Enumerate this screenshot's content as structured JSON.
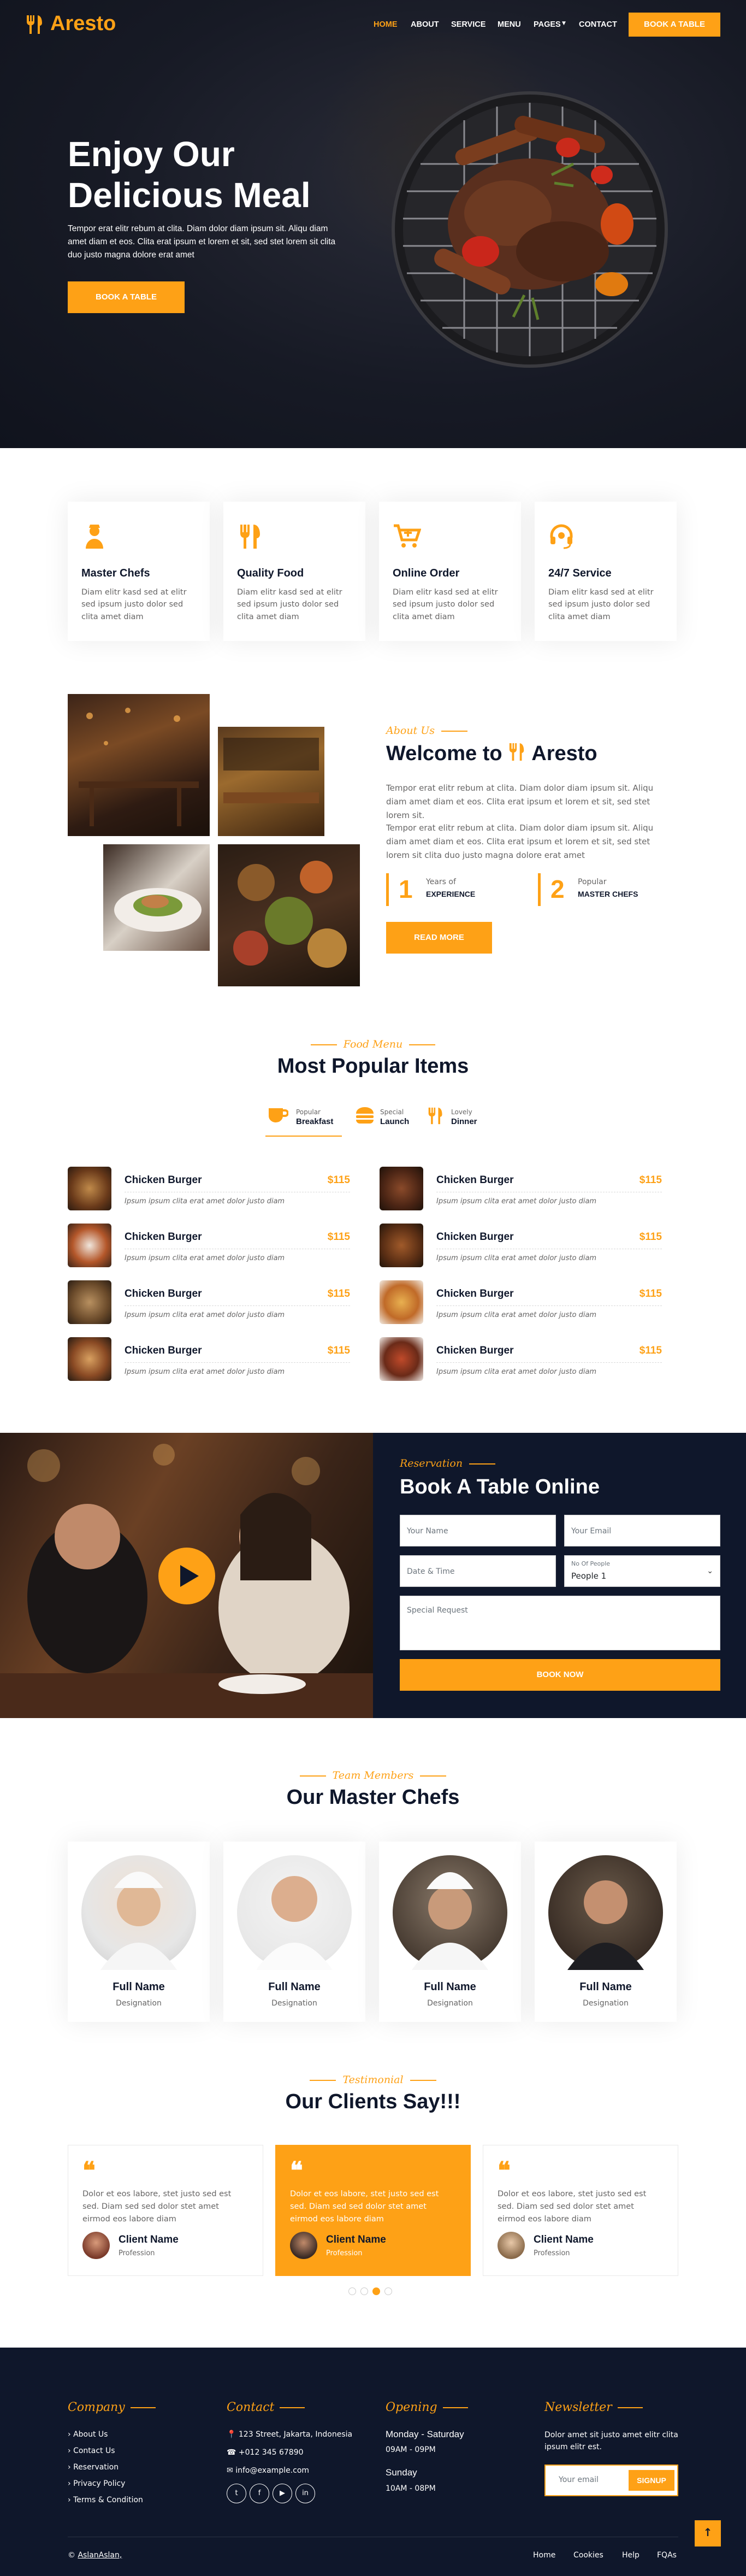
{
  "brand": {
    "name": "Aresto"
  },
  "nav": {
    "items": [
      "HOME",
      "ABOUT",
      "SERVICE",
      "MENU",
      "PAGES"
    ],
    "contact": "CONTACT",
    "cta": "BOOK A TABLE"
  },
  "hero": {
    "title_line1": "Enjoy Our",
    "title_line2": "Delicious Meal",
    "text_line1": "Tempor erat elitr rebum at clita. Diam dolor diam ipsum sit. Aliqu diam",
    "text_line2": "amet diam et eos. Clita erat ipsum et lorem et sit, sed stet lorem sit clita",
    "text_line3": "duo justo magna dolore erat amet",
    "button": "BOOK A TABLE"
  },
  "services": [
    {
      "title": "Master Chefs",
      "icon": "chef-icon",
      "text": "Diam elitr kasd sed at elitr sed ipsum justo dolor sed clita amet diam"
    },
    {
      "title": "Quality Food",
      "icon": "utensils-icon",
      "text": "Diam elitr kasd sed at elitr sed ipsum justo dolor sed clita amet diam"
    },
    {
      "title": "Online Order",
      "icon": "cart-icon",
      "text": "Diam elitr kasd sed at elitr sed ipsum justo dolor sed clita amet diam"
    },
    {
      "title": "24/7 Service",
      "icon": "headset-icon",
      "text": "Diam elitr kasd sed at elitr sed ipsum justo dolor sed clita amet diam"
    }
  ],
  "about": {
    "subtitle": "About Us",
    "title_prefix": "Welcome to",
    "title_brand": "Aresto",
    "para1": "Tempor erat elitr rebum at clita. Diam dolor diam ipsum sit. Aliqu diam amet diam et eos. Clita erat ipsum et lorem et sit, sed stet lorem sit.",
    "para2": "Tempor erat elitr rebum at clita. Diam dolor diam ipsum sit. Aliqu diam amet diam et eos. Clita erat ipsum et lorem et sit, sed stet lorem sit clita duo justo magna dolore erat amet",
    "stat1": {
      "num": "1",
      "label1": "Years of",
      "label2": "EXPERIENCE"
    },
    "stat2": {
      "num": "2",
      "label1": "Popular",
      "label2": "MASTER CHEFS"
    },
    "button": "READ MORE"
  },
  "menu": {
    "subtitle": "Food Menu",
    "title": "Most Popular Items",
    "tabs": [
      {
        "small": "Popular",
        "big": "Breakfast",
        "icon": "coffee-icon"
      },
      {
        "small": "Special",
        "big": "Launch",
        "icon": "burger-icon"
      },
      {
        "small": "Lovely",
        "big": "Dinner",
        "icon": "utensils-icon"
      }
    ],
    "items": [
      {
        "name": "Chicken Burger",
        "price": "$115",
        "desc": "Ipsum ipsum clita erat amet dolor justo diam"
      },
      {
        "name": "Chicken Burger",
        "price": "$115",
        "desc": "Ipsum ipsum clita erat amet dolor justo diam"
      },
      {
        "name": "Chicken Burger",
        "price": "$115",
        "desc": "Ipsum ipsum clita erat amet dolor justo diam"
      },
      {
        "name": "Chicken Burger",
        "price": "$115",
        "desc": "Ipsum ipsum clita erat amet dolor justo diam"
      },
      {
        "name": "Chicken Burger",
        "price": "$115",
        "desc": "Ipsum ipsum clita erat amet dolor justo diam"
      },
      {
        "name": "Chicken Burger",
        "price": "$115",
        "desc": "Ipsum ipsum clita erat amet dolor justo diam"
      },
      {
        "name": "Chicken Burger",
        "price": "$115",
        "desc": "Ipsum ipsum clita erat amet dolor justo diam"
      },
      {
        "name": "Chicken Burger",
        "price": "$115",
        "desc": "Ipsum ipsum clita erat amet dolor justo diam"
      }
    ]
  },
  "reservation": {
    "subtitle": "Reservation",
    "title": "Book A Table Online",
    "name_ph": "Your Name",
    "email_ph": "Your Email",
    "date_ph": "Date & Time",
    "people_label": "No Of People",
    "people_value": "People 1",
    "request_ph": "Special Request",
    "button": "BOOK NOW"
  },
  "team": {
    "subtitle": "Team Members",
    "title": "Our Master Chefs",
    "members": [
      {
        "name": "Full Name",
        "role": "Designation"
      },
      {
        "name": "Full Name",
        "role": "Designation"
      },
      {
        "name": "Full Name",
        "role": "Designation"
      },
      {
        "name": "Full Name",
        "role": "Designation"
      }
    ]
  },
  "testimonial": {
    "subtitle": "Testimonial",
    "title": "Our Clients Say!!!",
    "cards": [
      {
        "text": "Dolor et eos labore, stet justo sed est sed. Diam sed sed dolor stet amet eirmod eos labore diam",
        "name": "Client Name",
        "role": "Profession"
      },
      {
        "text": "Dolor et eos labore, stet justo sed est sed. Diam sed sed dolor stet amet eirmod eos labore diam",
        "name": "Client Name",
        "role": "Profession"
      },
      {
        "text": "Dolor et eos labore, stet justo sed est sed. Diam sed sed dolor stet amet eirmod eos labore diam",
        "name": "Client Name",
        "role": "Profession"
      }
    ]
  },
  "footer": {
    "company": {
      "title": "Company",
      "links": [
        "About Us",
        "Contact Us",
        "Reservation",
        "Privacy Policy",
        "Terms & Condition"
      ]
    },
    "contact": {
      "title": "Contact",
      "address": "123 Street, Jakarta, Indonesia",
      "phone": "+012 345 67890",
      "email": "info@example.com",
      "social": [
        "twitter-icon",
        "facebook-icon",
        "youtube-icon",
        "linkedin-icon"
      ]
    },
    "opening": {
      "title": "Opening",
      "day1": "Monday - Saturday",
      "hours1": "09AM - 09PM",
      "day2": "Sunday",
      "hours2": "10AM - 08PM"
    },
    "newsletter": {
      "title": "Newsletter",
      "text": "Dolor amet sit justo amet elitr clita ipsum elitr est.",
      "placeholder": "Your email",
      "button": "SIGNUP"
    },
    "copyright_symbol": "©",
    "copyright": "AslanAslan,",
    "bottom_links": [
      "Home",
      "Cookies",
      "Help",
      "FQAs"
    ]
  },
  "colors": {
    "primary": "#FEA116",
    "dark": "#0F172B"
  }
}
